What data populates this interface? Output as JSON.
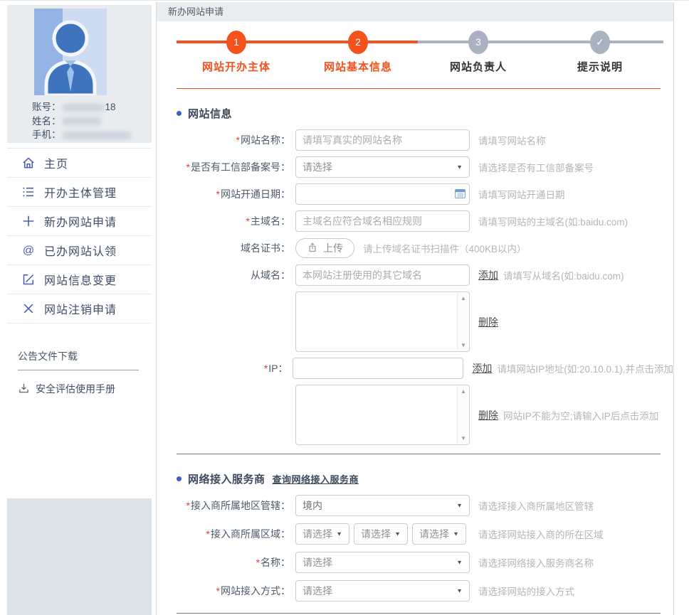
{
  "marks": {
    "required": "*",
    "caret": "▼",
    "scroll_up": "▲",
    "scroll_down": "▼"
  },
  "breadcrumb": {
    "title": "新办网站申请"
  },
  "sidebar": {
    "user": {
      "account_label": "账号：",
      "account_suffix": "18",
      "name_label": "姓名：",
      "phone_label": "手机："
    },
    "menu": [
      {
        "icon": "home-icon",
        "label": "主页"
      },
      {
        "icon": "list-icon",
        "label": "开办主体管理"
      },
      {
        "icon": "plus-icon",
        "label": "新办网站申请"
      },
      {
        "icon": "at-icon",
        "label": "已办网站认领"
      },
      {
        "icon": "edit-icon",
        "label": "网站信息变更"
      },
      {
        "icon": "close-icon",
        "label": "网站注销申请"
      }
    ],
    "downloads": {
      "title": "公告文件下载",
      "item": "安全评估使用手册"
    }
  },
  "stepper": {
    "steps": [
      {
        "num": "1",
        "label": "网站开办主体"
      },
      {
        "num": "2",
        "label": "网站基本信息"
      },
      {
        "num": "3",
        "label": "网站负责人"
      },
      {
        "num": "✓",
        "label": "提示说明"
      }
    ]
  },
  "site_info": {
    "title": "网站信息",
    "name": {
      "label": "网站名称：",
      "placeholder": "请填写真实的网站名称",
      "hint": "请填写网站名称"
    },
    "icp": {
      "label": "是否有工信部备案号：",
      "value": "请选择",
      "hint": "请选择是否有工信部备案号"
    },
    "open_date": {
      "label": "网站开通日期：",
      "hint": "请填写网站开通日期"
    },
    "main_domain": {
      "label": "主域名：",
      "placeholder": "主域名应符合域名相应规则",
      "hint": "请填写网站的主域名(如:baidu.com)"
    },
    "cert": {
      "label": "域名证书：",
      "button": "上传",
      "hint": "请上传域名证书扫描件（400KB以内）"
    },
    "sub_domain": {
      "label": "从域名：",
      "placeholder": "本网站注册使用的其它域名",
      "add": "添加",
      "hint": "请填写从域名(如:baidu.com)",
      "delete": "删除"
    },
    "ip": {
      "label": "IP：",
      "add": "添加",
      "hint": "请填网站IP地址(如:20.10.0.1),并点击添加",
      "delete": "删除",
      "empty_hint": "网站IP不能为空;请输入IP后点击添加"
    }
  },
  "isp": {
    "title": "网络接入服务商",
    "query_link": "查询网络接入服务商",
    "jurisdiction": {
      "label": "接入商所属地区管辖：",
      "value": "境内",
      "hint": "请选择接入商所属地区管辖"
    },
    "region": {
      "label": "接入商所属区域：",
      "values": [
        "请选择",
        "请选择",
        "请选择"
      ],
      "hint": "请选择网站接入商的所在区域"
    },
    "name": {
      "label": "名称：",
      "value": "请选择",
      "hint": "请选择网络接入服务商名称"
    },
    "access_mode": {
      "label": "网站接入方式：",
      "value": "请选择",
      "hint": "请选择网站的接入方式"
    }
  },
  "colors": {
    "accent_orange": "#f4511c",
    "step_gray": "#a8b2c0",
    "bullet_blue": "#3f5ec0",
    "menu_icon_blue": "#4a5cb5",
    "required_red": "#e43b3b",
    "breadcrumb_bg": "#e9edf1",
    "panel_bg": "#e8ecef"
  }
}
